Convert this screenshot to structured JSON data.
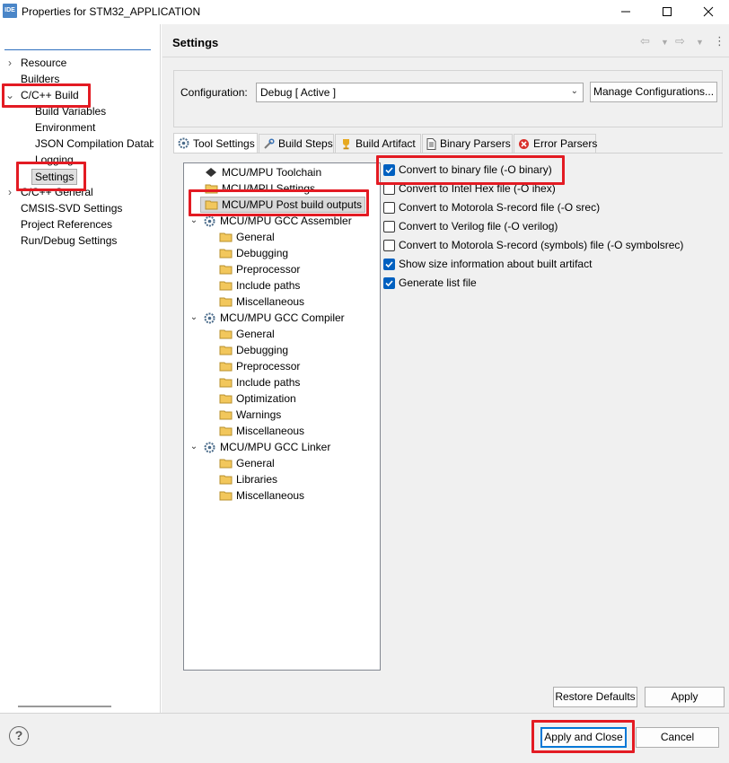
{
  "window": {
    "app_icon": "IDE",
    "title": "Properties for STM32_APPLICATION",
    "minimize": "—",
    "maximize": "☐",
    "close": "✕"
  },
  "filter": {
    "value": ""
  },
  "left_nav": {
    "items": [
      {
        "label": "Resource"
      },
      {
        "label": "Builders"
      },
      {
        "label": "C/C++ Build"
      },
      {
        "label": "Build Variables"
      },
      {
        "label": "Environment"
      },
      {
        "label": "JSON Compilation Datab"
      },
      {
        "label": "Logging"
      },
      {
        "label": "Settings"
      },
      {
        "label": "C/C++ General"
      },
      {
        "label": "CMSIS-SVD Settings"
      },
      {
        "label": "Project References"
      },
      {
        "label": "Run/Debug Settings"
      }
    ]
  },
  "header": {
    "title": "Settings"
  },
  "configuration": {
    "label": "Configuration:",
    "value": "Debug  [ Active ]",
    "manage_label": "Manage Configurations..."
  },
  "tabs": [
    {
      "label": "Tool Settings"
    },
    {
      "label": "Build Steps"
    },
    {
      "label": "Build Artifact"
    },
    {
      "label": "Binary Parsers"
    },
    {
      "label": "Error Parsers"
    }
  ],
  "tree": {
    "items": [
      {
        "label": "MCU/MPU Toolchain"
      },
      {
        "label": "MCU/MPU Settings"
      },
      {
        "label": "MCU/MPU Post build outputs"
      },
      {
        "label": "MCU/MPU GCC Assembler"
      },
      {
        "label": "General"
      },
      {
        "label": "Debugging"
      },
      {
        "label": "Preprocessor"
      },
      {
        "label": "Include paths"
      },
      {
        "label": "Miscellaneous"
      },
      {
        "label": "MCU/MPU GCC Compiler"
      },
      {
        "label": "General"
      },
      {
        "label": "Debugging"
      },
      {
        "label": "Preprocessor"
      },
      {
        "label": "Include paths"
      },
      {
        "label": "Optimization"
      },
      {
        "label": "Warnings"
      },
      {
        "label": "Miscellaneous"
      },
      {
        "label": "MCU/MPU GCC Linker"
      },
      {
        "label": "General"
      },
      {
        "label": "Libraries"
      },
      {
        "label": "Miscellaneous"
      }
    ]
  },
  "options": [
    {
      "label": "Convert to binary file (-O binary)",
      "checked": true
    },
    {
      "label": "Convert to Intel Hex file (-O ihex)",
      "checked": false
    },
    {
      "label": "Convert to Motorola S-record file (-O srec)",
      "checked": false
    },
    {
      "label": "Convert to Verilog file (-O verilog)",
      "checked": false
    },
    {
      "label": "Convert to Motorola S-record (symbols) file (-O symbolsrec)",
      "checked": false
    },
    {
      "label": "Show size information about built artifact",
      "checked": true
    },
    {
      "label": "Generate list file",
      "checked": true
    }
  ],
  "buttons": {
    "restore_defaults": "Restore Defaults",
    "apply": "Apply",
    "apply_and_close": "Apply and Close",
    "cancel": "Cancel",
    "help": "?"
  },
  "colors": {
    "highlight_box": "#e31b23",
    "checkbox_checked": "#0060c0"
  }
}
